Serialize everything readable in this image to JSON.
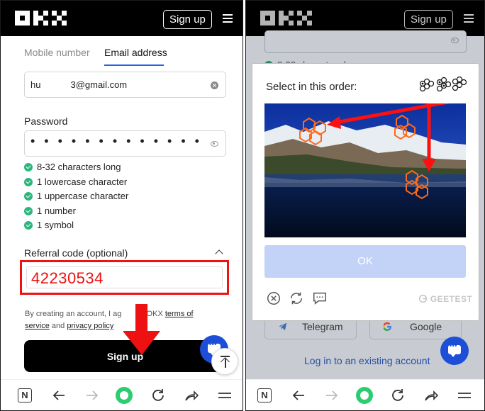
{
  "left": {
    "header": {
      "signup_label": "Sign up"
    },
    "tabs": [
      {
        "label": "Mobile number"
      },
      {
        "label": "Email address"
      }
    ],
    "email": {
      "prefix": "hu",
      "suffix": "3@gmail.com"
    },
    "password": {
      "label": "Password",
      "mask": "• • • • • • • • • • • • •"
    },
    "requirements": [
      "8-32 characters long",
      "1 lowercase character",
      "1 uppercase character",
      "1 number",
      "1 symbol"
    ],
    "referral": {
      "label": "Referral code (optional)",
      "value": "42230534"
    },
    "terms": {
      "text_a": "By creating an account, I ag",
      "text_b": "o OKX ",
      "link_terms": "terms of service",
      "text_c": " and ",
      "link_privacy": "privacy policy"
    },
    "submit_label": "Sign up"
  },
  "right": {
    "header": {
      "signup_label": "Sign up"
    },
    "background": {
      "requirement": "8-32 characters long",
      "social": [
        "Telegram",
        "Google"
      ],
      "login_link": "Log in to an existing account"
    },
    "captcha": {
      "title": "Select in this order:",
      "ok_label": "OK",
      "brand": "GEETEST"
    }
  },
  "colors": {
    "accent": "#2563eb",
    "highlight": "#e11111",
    "success": "#2cb67d",
    "fab": "#1d4ed8"
  }
}
